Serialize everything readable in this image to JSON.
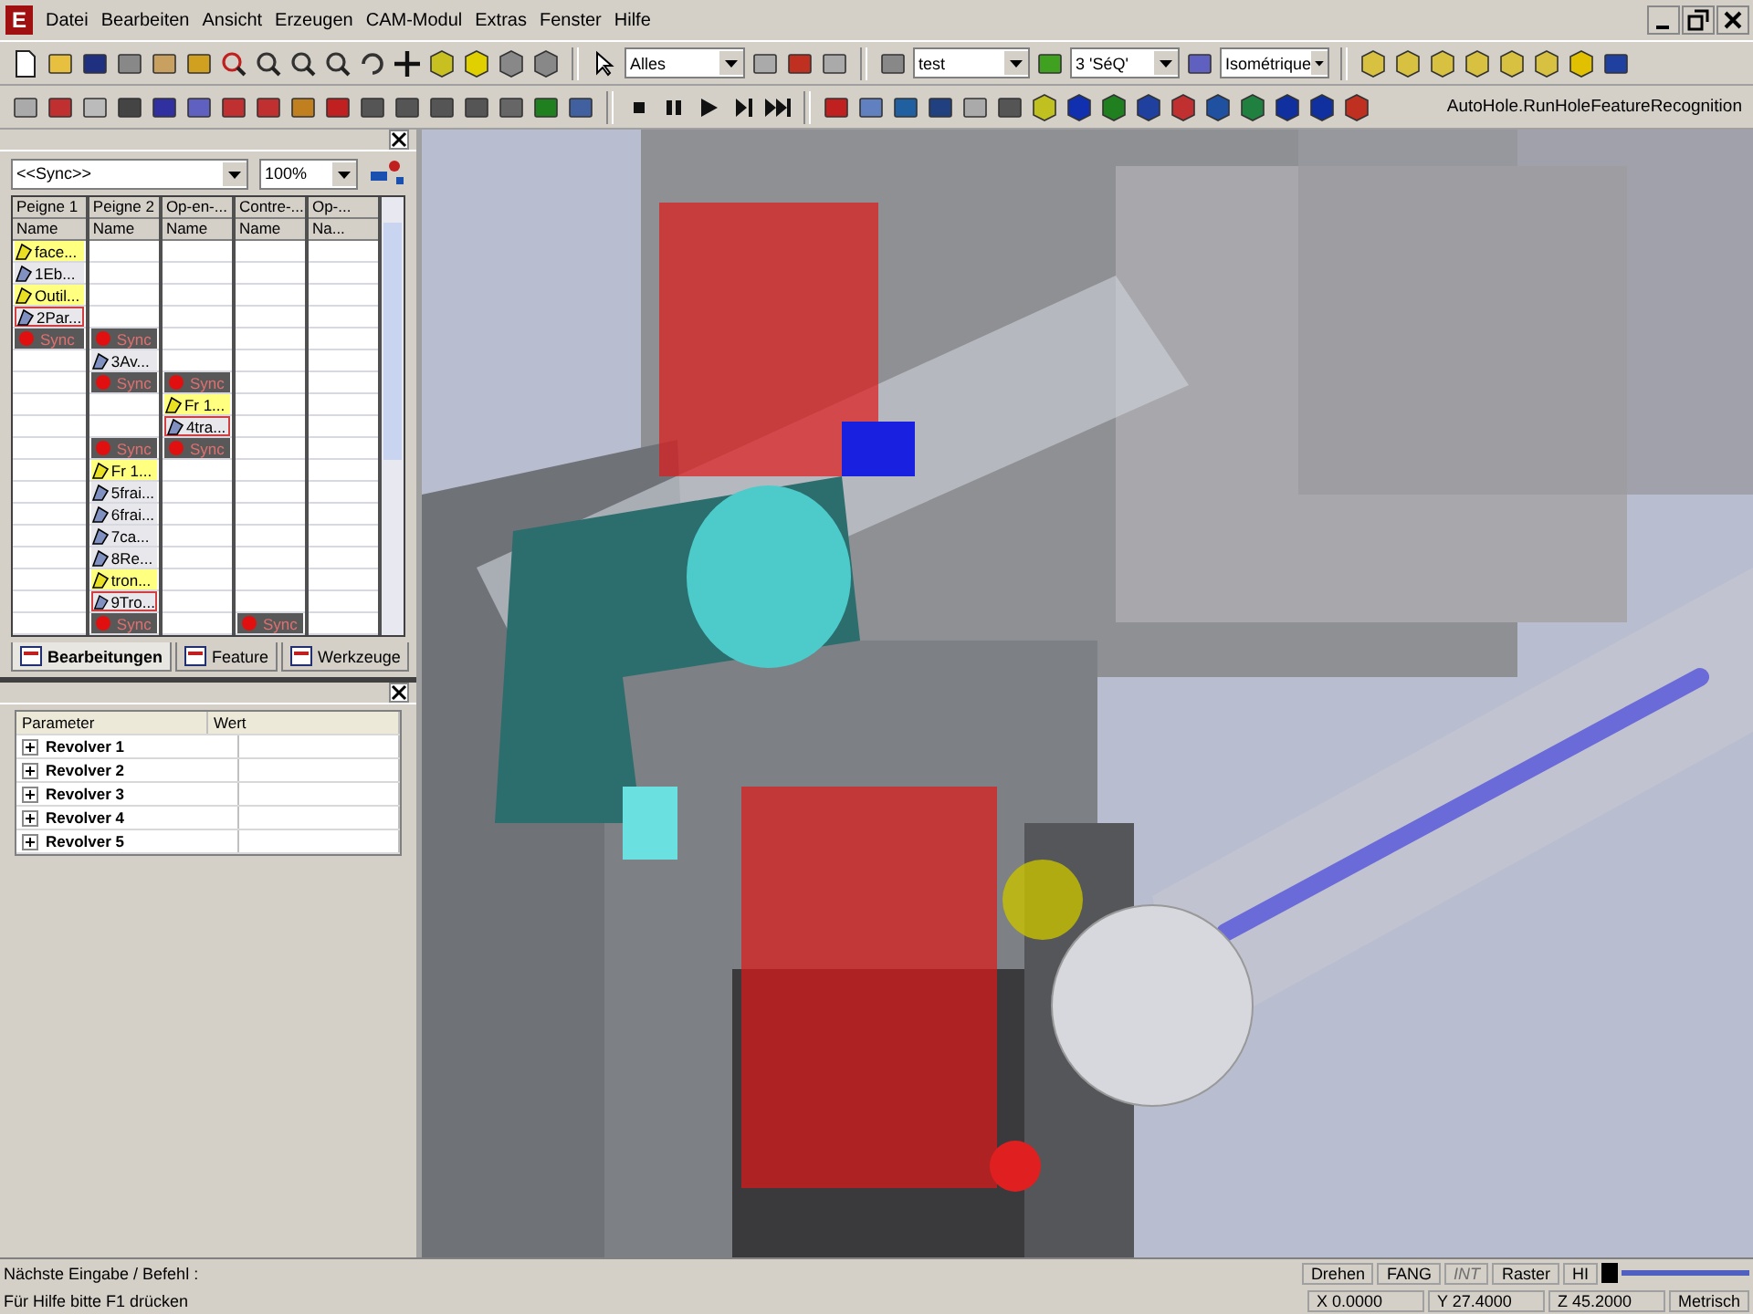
{
  "window": {
    "logo": "E",
    "menu": [
      "Datei",
      "Bearbeiten",
      "Ansicht",
      "Erzeugen",
      "CAM-Modul",
      "Extras",
      "Fenster",
      "Hilfe"
    ]
  },
  "toolbar": {
    "filter": "Alles",
    "part": "test",
    "layer": "3 'SéQ'",
    "view": "Isométrique",
    "command": "AutoHole.RunHoleFeatureRecognition"
  },
  "operations_panel": {
    "sync_filter": "<<Sync>>",
    "zoom": "100%",
    "columns": [
      {
        "title": "Peigne 1",
        "sub": "Name"
      },
      {
        "title": "Peigne 2",
        "sub": "Name"
      },
      {
        "title": "Op-en-...",
        "sub": "Name"
      },
      {
        "title": "Contre-...",
        "sub": "Name"
      },
      {
        "title": "Op-...",
        "sub": "Na..."
      }
    ],
    "rows": [
      [
        {
          "kind": "op",
          "text": "face...",
          "highlighted": true,
          "outlined": false
        },
        null,
        null,
        null,
        null
      ],
      [
        {
          "kind": "op",
          "text": "1Eb...",
          "highlighted": false,
          "outlined": false
        },
        null,
        null,
        null,
        null
      ],
      [
        {
          "kind": "op",
          "text": "Outil...",
          "highlighted": true,
          "outlined": false
        },
        null,
        null,
        null,
        null
      ],
      [
        {
          "kind": "op",
          "text": "2Par...",
          "highlighted": false,
          "outlined": true
        },
        null,
        null,
        null,
        null
      ],
      [
        {
          "kind": "sync",
          "text": "Sync"
        },
        {
          "kind": "sync",
          "text": "Sync"
        },
        null,
        null,
        null
      ],
      [
        null,
        {
          "kind": "op",
          "text": "3Av...",
          "highlighted": false,
          "outlined": false
        },
        null,
        null,
        null
      ],
      [
        null,
        {
          "kind": "sync",
          "text": "Sync"
        },
        {
          "kind": "sync",
          "text": "Sync"
        },
        null,
        null
      ],
      [
        null,
        null,
        {
          "kind": "op",
          "text": "Fr 1...",
          "highlighted": true,
          "outlined": false
        },
        null,
        null
      ],
      [
        null,
        null,
        {
          "kind": "op",
          "text": "4tra...",
          "highlighted": false,
          "outlined": true
        },
        null,
        null
      ],
      [
        null,
        {
          "kind": "sync",
          "text": "Sync"
        },
        {
          "kind": "sync",
          "text": "Sync"
        },
        null,
        null
      ],
      [
        null,
        {
          "kind": "op",
          "text": "Fr 1...",
          "highlighted": true,
          "outlined": false
        },
        null,
        null,
        null
      ],
      [
        null,
        {
          "kind": "op",
          "text": "5frai...",
          "highlighted": false,
          "outlined": false
        },
        null,
        null,
        null
      ],
      [
        null,
        {
          "kind": "op",
          "text": "6frai...",
          "highlighted": false,
          "outlined": false
        },
        null,
        null,
        null
      ],
      [
        null,
        {
          "kind": "op",
          "text": "7ca...",
          "highlighted": false,
          "outlined": false
        },
        null,
        null,
        null
      ],
      [
        null,
        {
          "kind": "op",
          "text": "8Re...",
          "highlighted": false,
          "outlined": false
        },
        null,
        null,
        null
      ],
      [
        null,
        {
          "kind": "op",
          "text": "tron...",
          "highlighted": true,
          "outlined": false
        },
        null,
        null,
        null
      ],
      [
        null,
        {
          "kind": "op",
          "text": "9Tro...",
          "highlighted": false,
          "outlined": true
        },
        null,
        null,
        null
      ],
      [
        null,
        {
          "kind": "sync",
          "text": "Sync"
        },
        null,
        {
          "kind": "sync",
          "text": "Sync"
        },
        null
      ]
    ],
    "tabs": [
      {
        "label": "Bearbeitungen",
        "selected": true
      },
      {
        "label": "Feature",
        "selected": false
      },
      {
        "label": "Werkzeuge",
        "selected": false
      }
    ]
  },
  "parameter_panel": {
    "columns": [
      "Parameter",
      "Wert"
    ],
    "rows": [
      {
        "name": "Revolver 1",
        "expanded": false
      },
      {
        "name": "Revolver 2",
        "expanded": false
      },
      {
        "name": "Revolver 3",
        "expanded": false
      },
      {
        "name": "Revolver 4",
        "expanded": false
      },
      {
        "name": "Revolver 5",
        "expanded": false
      }
    ]
  },
  "status_bar": {
    "prompt": "Nächste Eingabe / Befehl :",
    "help": "Für Hilfe bitte F1 drücken",
    "indicators": [
      {
        "label": "Drehen",
        "disabled": false
      },
      {
        "label": "FANG",
        "disabled": false
      },
      {
        "label": "INT",
        "disabled": true
      },
      {
        "label": "Raster",
        "disabled": false
      },
      {
        "label": "HI",
        "disabled": false
      }
    ],
    "coords": [
      "X 0.0000",
      "Y 27.4000",
      "Z 45.2000"
    ],
    "units": "Metrisch"
  }
}
